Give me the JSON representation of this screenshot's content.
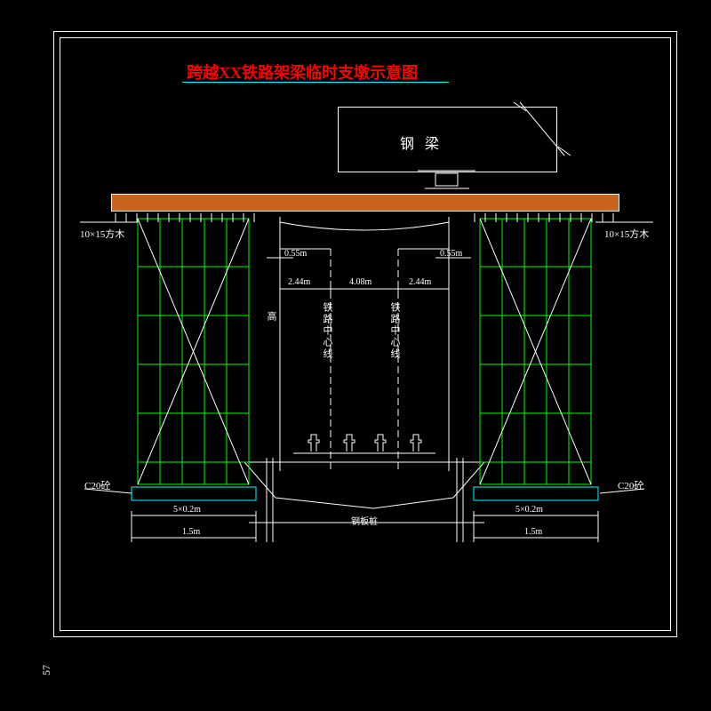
{
  "title": "跨越XX铁路架梁临时支墩示意图",
  "steel_beam": "钢    梁",
  "timber_left": "10×15方木",
  "timber_right": "10×15方木",
  "rail_cl_left": "铁路中心线",
  "rail_cl_right": "铁路中心线",
  "height_label": "高",
  "dim_055_l": "0.55m",
  "dim_055_r": "0.55m",
  "dim_244_l": "2.44m",
  "dim_408": "4.08m",
  "dim_244_r": "2.44m",
  "c20_l": "C20砼",
  "c20_r": "C20砼",
  "conc_l": "5×0.2m",
  "conc_r": "5×0.2m",
  "base_l": "1.5m",
  "base_r": "1.5m",
  "pile": "钢板桩",
  "page": "57"
}
